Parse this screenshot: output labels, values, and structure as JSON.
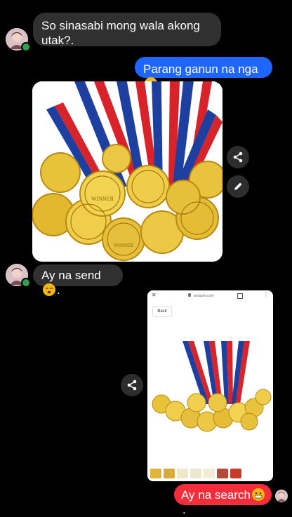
{
  "messages": {
    "m1": "So sinasabi mong wala akong utak?.",
    "m2": "Parang ganun na nga",
    "m3": "Ay na send",
    "m4": "Ay na search"
  },
  "medal_inscription": "WINNER",
  "screenshot": {
    "url_text": "amazon.com",
    "back_label": "Back"
  },
  "icons": {
    "share": "share-icon",
    "edit": "edit-pencil-icon",
    "close": "close-icon",
    "lock": "lock-icon",
    "more": "more-vertical-icon"
  },
  "colors": {
    "background": "#000000",
    "incoming_bubble": "#303030",
    "outgoing_bubble": "#1f66ff",
    "search_bubble": "#f52d3a",
    "online": "#31a24c"
  }
}
